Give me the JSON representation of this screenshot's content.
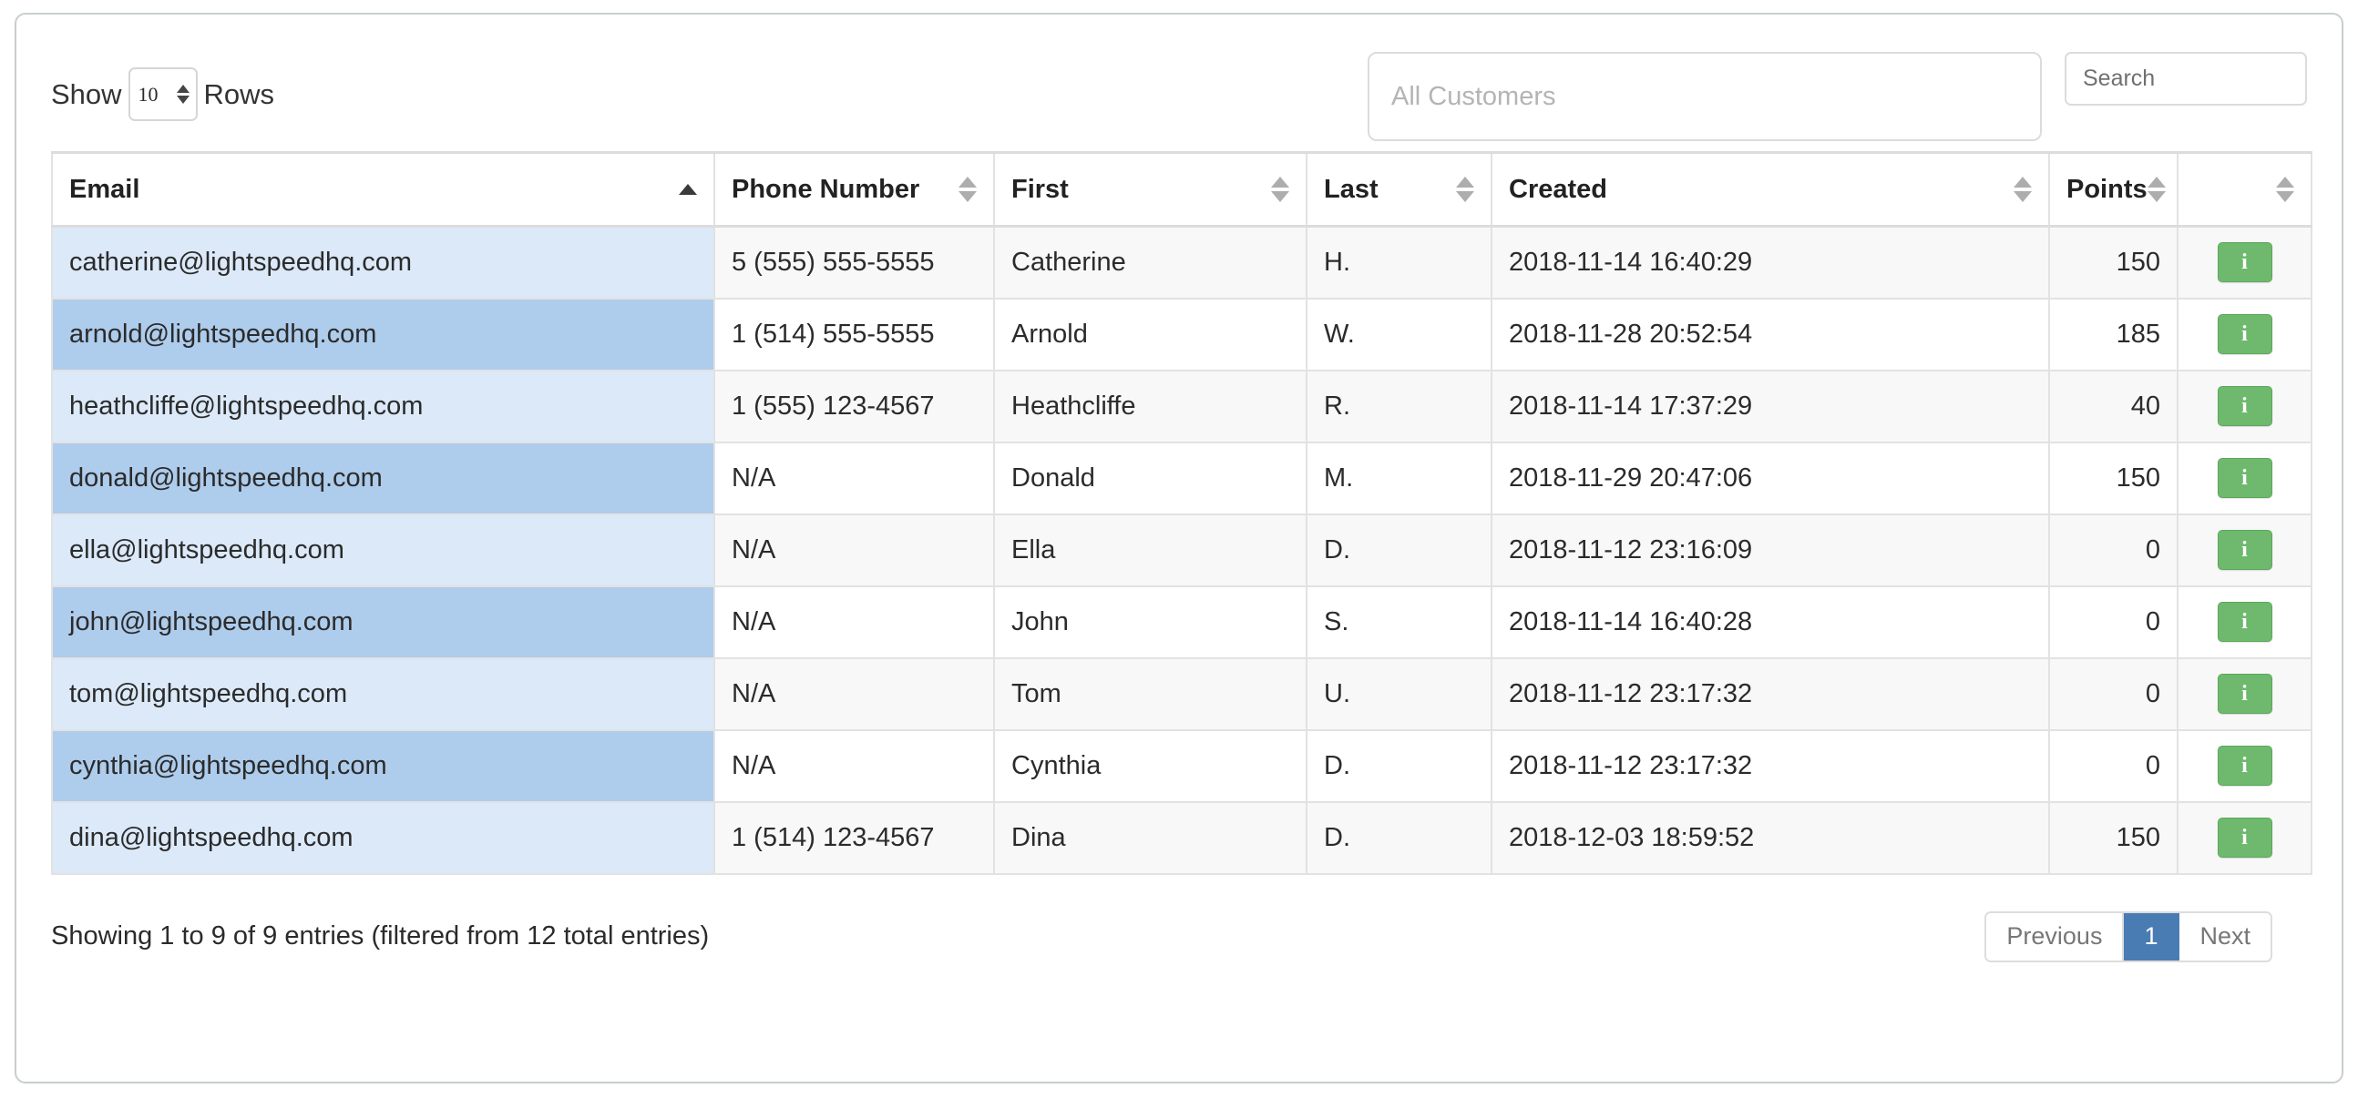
{
  "controls": {
    "show_label": "Show",
    "rows_value": "10",
    "rows_label": "Rows",
    "customer_filter_placeholder": "All Customers",
    "search_placeholder": "Search"
  },
  "table": {
    "columns": [
      {
        "label": "Email",
        "sort": "asc",
        "align": "left"
      },
      {
        "label": "Phone Number",
        "sort": "none",
        "align": "left"
      },
      {
        "label": "First",
        "sort": "none",
        "align": "left"
      },
      {
        "label": "Last",
        "sort": "none",
        "align": "left"
      },
      {
        "label": "Created",
        "sort": "none",
        "align": "left"
      },
      {
        "label": "Points",
        "sort": "none",
        "align": "left"
      },
      {
        "label": "",
        "sort": "none",
        "align": "left"
      }
    ],
    "rows": [
      {
        "email": "catherine@lightspeedhq.com",
        "phone": "5 (555) 555-5555",
        "first": "Catherine",
        "last": "H.",
        "created": "2018-11-14 16:40:29",
        "points": "150",
        "action": "i"
      },
      {
        "email": "arnold@lightspeedhq.com",
        "phone": "1 (514) 555-5555",
        "first": "Arnold",
        "last": "W.",
        "created": "2018-11-28 20:52:54",
        "points": "185",
        "action": "i"
      },
      {
        "email": "heathcliffe@lightspeedhq.com",
        "phone": "1 (555) 123-4567",
        "first": "Heathcliffe",
        "last": "R.",
        "created": "2018-11-14 17:37:29",
        "points": "40",
        "action": "i"
      },
      {
        "email": "donald@lightspeedhq.com",
        "phone": "N/A",
        "first": "Donald",
        "last": "M.",
        "created": "2018-11-29 20:47:06",
        "points": "150",
        "action": "i"
      },
      {
        "email": "ella@lightspeedhq.com",
        "phone": "N/A",
        "first": "Ella",
        "last": "D.",
        "created": "2018-11-12 23:16:09",
        "points": "0",
        "action": "i"
      },
      {
        "email": "john@lightspeedhq.com",
        "phone": "N/A",
        "first": "John",
        "last": "S.",
        "created": "2018-11-14 16:40:28",
        "points": "0",
        "action": "i"
      },
      {
        "email": "tom@lightspeedhq.com",
        "phone": "N/A",
        "first": "Tom",
        "last": "U.",
        "created": "2018-11-12 23:17:32",
        "points": "0",
        "action": "i"
      },
      {
        "email": "cynthia@lightspeedhq.com",
        "phone": "N/A",
        "first": "Cynthia",
        "last": "D.",
        "created": "2018-11-12 23:17:32",
        "points": "0",
        "action": "i"
      },
      {
        "email": "dina@lightspeedhq.com",
        "phone": "1 (514) 123-4567",
        "first": "Dina",
        "last": "D.",
        "created": "2018-12-03 18:59:52",
        "points": "150",
        "action": "i"
      }
    ]
  },
  "footer": {
    "info": "Showing 1 to 9 of 9 entries (filtered from 12 total entries)",
    "pagination": {
      "previous": "Previous",
      "pages": [
        "1"
      ],
      "active_page": "1",
      "next": "Next"
    }
  },
  "colors": {
    "sorted_row_light": "#dbe9f9",
    "sorted_row_dark": "#aeccec",
    "row_odd": "#f8f8f8",
    "row_even": "#ffffff",
    "action_button": "#6eb96e",
    "pagination_active": "#4a7cb4",
    "card_border": "#c9cfcf"
  }
}
